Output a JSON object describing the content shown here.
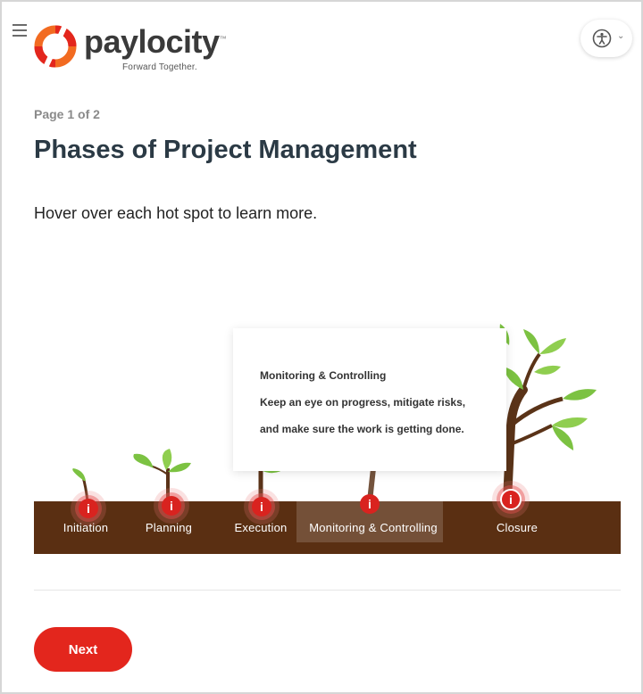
{
  "header": {
    "brand_name": "paylocity",
    "tagline": "Forward Together.",
    "trademark": "™"
  },
  "colors": {
    "accent_red": "#e3261d",
    "logo_orange": "#f26b21",
    "ground_brown": "#5a2f12",
    "leaf_green": "#7cc242",
    "title_text": "#2b3a45"
  },
  "content": {
    "page_count": "Page 1 of 2",
    "title": "Phases of Project Management",
    "instruction": "Hover over each hot spot to learn more."
  },
  "hotspots": [
    {
      "label": "Initiation",
      "icon": "info-icon"
    },
    {
      "label": "Planning",
      "icon": "info-icon"
    },
    {
      "label": "Execution",
      "icon": "info-icon"
    },
    {
      "label": "Monitoring & Controlling",
      "icon": "info-icon",
      "active": true
    },
    {
      "label": "Closure",
      "icon": "info-icon"
    }
  ],
  "hotspot_glyph": "i",
  "tooltip": {
    "title": "Monitoring & Controlling",
    "line1": "Keep an eye on progress, mitigate risks,",
    "line2": "and make sure the work is getting done."
  },
  "navigation": {
    "next_label": "Next"
  },
  "icons": {
    "menu": "hamburger-menu-icon",
    "accessibility": "accessibility-icon",
    "dropdown": "chevron-down-icon"
  }
}
